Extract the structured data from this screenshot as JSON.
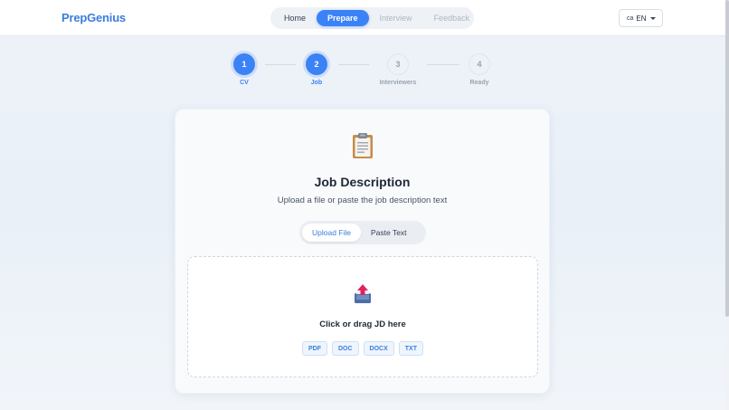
{
  "header": {
    "brand": "PrepGenius",
    "nav": [
      {
        "label": "Home",
        "state": "normal"
      },
      {
        "label": "Prepare",
        "state": "active"
      },
      {
        "label": "Interview",
        "state": "disabled"
      },
      {
        "label": "Feedback",
        "state": "disabled"
      }
    ],
    "language": {
      "flag_code": "ca",
      "code": "EN"
    }
  },
  "stepper": {
    "steps": [
      {
        "number": "1",
        "label": "CV",
        "status": "done"
      },
      {
        "number": "2",
        "label": "Job",
        "status": "current"
      },
      {
        "number": "3",
        "label": "Interviewers",
        "status": "todo"
      },
      {
        "number": "4",
        "label": "Ready",
        "status": "todo"
      }
    ]
  },
  "card": {
    "icon": "clipboard-icon",
    "title": "Job Description",
    "subtitle": "Upload a file or paste the job description text",
    "tabs": [
      {
        "label": "Upload File",
        "active": true
      },
      {
        "label": "Paste Text",
        "active": false
      }
    ],
    "dropzone": {
      "icon": "upload-tray-icon",
      "text": "Click or drag JD here",
      "formats": [
        "PDF",
        "DOC",
        "DOCX",
        "TXT"
      ]
    }
  },
  "colors": {
    "accent": "#3b82f6",
    "brand": "#3b7ddd",
    "muted": "#9aa3af"
  }
}
